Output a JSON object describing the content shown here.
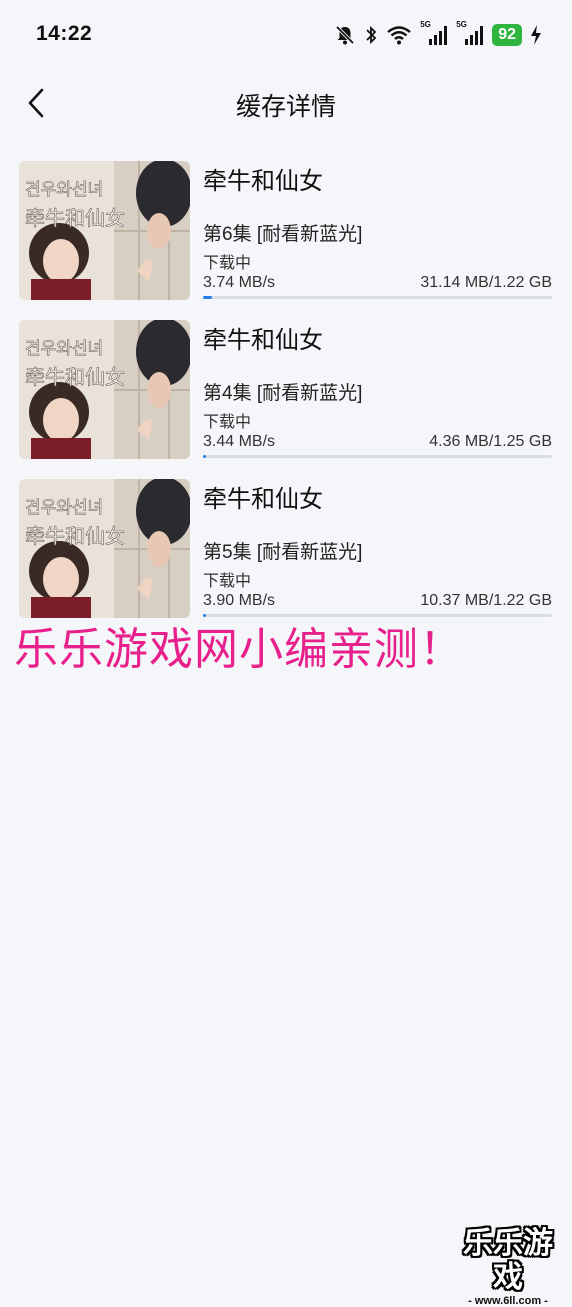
{
  "status_bar": {
    "time": "14:22",
    "network_1": "5G",
    "network_2": "5G",
    "battery": "92",
    "icons": [
      "bell-muted-icon",
      "bluetooth-icon",
      "wifi-icon",
      "signal-5g-icon",
      "signal-5g-icon",
      "battery-icon",
      "charging-icon"
    ]
  },
  "header": {
    "title": "缓存详情",
    "back_icon": "chevron-left-icon"
  },
  "downloads": [
    {
      "title": "牵牛和仙女",
      "episode": "第6集 [耐看新蓝光]",
      "status": "下载中",
      "speed": "3.74 MB/s",
      "size": "31.14 MB/1.22 GB",
      "progress": 0.025,
      "poster_text_1": "견우와선녀",
      "poster_text_2": "牵牛和仙女"
    },
    {
      "title": "牵牛和仙女",
      "episode": "第4集 [耐看新蓝光]",
      "status": "下载中",
      "speed": "3.44 MB/s",
      "size": "4.36 MB/1.25 GB",
      "progress": 0.0034,
      "poster_text_1": "견우와선녀",
      "poster_text_2": "牵牛和仙女"
    },
    {
      "title": "牵牛和仙女",
      "episode": "第5集 [耐看新蓝光]",
      "status": "下载中",
      "speed": "3.90 MB/s",
      "size": "10.37 MB/1.22 GB",
      "progress": 0.0083,
      "poster_text_1": "견우와선녀",
      "poster_text_2": "牵牛和仙女"
    }
  ],
  "watermark": "乐乐游戏网小编亲测！",
  "corner_logo": {
    "name": "乐乐游戏",
    "url": "- www.6ll.com -"
  },
  "colors": {
    "background": "#f5f6f9",
    "progress": "#1f7ee8",
    "battery": "#2fb43f",
    "watermark": "#e8208c"
  }
}
